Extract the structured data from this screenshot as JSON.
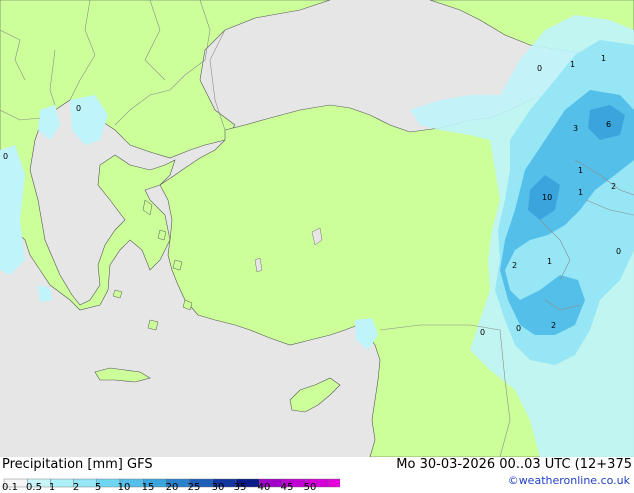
{
  "map": {
    "colors": {
      "sea": "#e6e6e6",
      "land": "#ccff99",
      "precip_light": "#bff4fb",
      "precip_mid": "#96e6f6",
      "precip_heavy": "#54bfe9",
      "precip_strong": "#3ba4dc",
      "border": "#8c8c8c",
      "coast": "#555555"
    },
    "value_labels": [
      "1",
      "1",
      "0",
      "3",
      "6",
      "10",
      "1",
      "2",
      "1",
      "2",
      "0",
      "0",
      "2",
      "1",
      "0",
      "0",
      "0"
    ]
  },
  "footer": {
    "title": "Precipitation [mm]  GFS",
    "datetime": "Mo 30-03-2026 00..03 UTC (12+375",
    "credit": "©weatheronline.co.uk"
  },
  "legend": {
    "colors": [
      "#f5f5f5",
      "#c8f5fa",
      "#aef0f8",
      "#96e6f6",
      "#6fd6f2",
      "#54bfe9",
      "#3ba4dc",
      "#2a82cc",
      "#1d5fb8",
      "#1238a0",
      "#0a1a86",
      "#a000c8",
      "#c000d2",
      "#d400d8",
      "#e600dc",
      "#f000e0"
    ],
    "ticks": [
      "0.1",
      "0.5",
      "1",
      "2",
      "5",
      "10",
      "15",
      "20",
      "25",
      "30",
      "35",
      "40",
      "45",
      "50"
    ]
  }
}
